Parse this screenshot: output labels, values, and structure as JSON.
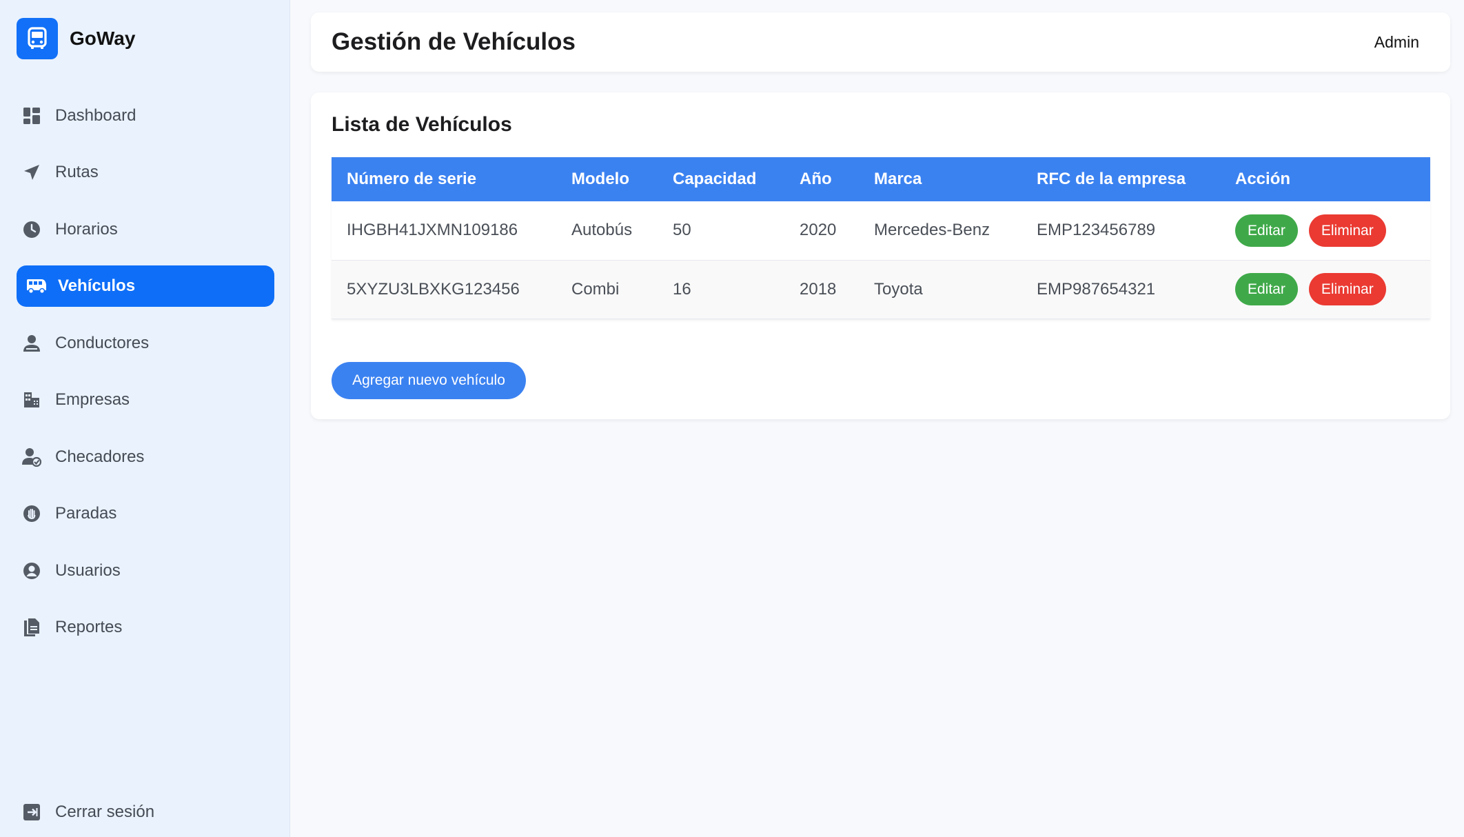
{
  "brand": {
    "name": "GoWay",
    "logo_icon": "bus-icon",
    "color": "#1170f7"
  },
  "sidebar": {
    "items": [
      {
        "label": "Dashboard",
        "icon": "dashboard-icon",
        "active": false
      },
      {
        "label": "Rutas",
        "icon": "navigation-arrow-icon",
        "active": false
      },
      {
        "label": "Horarios",
        "icon": "clock-icon",
        "active": false
      },
      {
        "label": "Vehículos",
        "icon": "bus-icon",
        "active": true
      },
      {
        "label": "Conductores",
        "icon": "driver-icon",
        "active": false
      },
      {
        "label": "Empresas",
        "icon": "building-icon",
        "active": false
      },
      {
        "label": "Checadores",
        "icon": "user-check-icon",
        "active": false
      },
      {
        "label": "Paradas",
        "icon": "hand-stop-icon",
        "active": false
      },
      {
        "label": "Usuarios",
        "icon": "user-circle-icon",
        "active": false
      },
      {
        "label": "Reportes",
        "icon": "document-copy-icon",
        "active": false
      }
    ],
    "logout_label": "Cerrar sesión",
    "logout_icon": "logout-icon"
  },
  "header": {
    "title": "Gestión de Vehículos",
    "user": "Admin"
  },
  "main": {
    "card_title": "Lista de Vehículos",
    "table": {
      "columns": [
        "Número de serie",
        "Modelo",
        "Capacidad",
        "Año",
        "Marca",
        "RFC de la empresa",
        "Acción"
      ],
      "rows": [
        [
          "IHGBH41JXMN109186",
          "Autobús",
          "50",
          "2020",
          "Mercedes-Benz",
          "EMP123456789"
        ],
        [
          "5XYZU3LBXKG123456",
          "Combi",
          "16",
          "2018",
          "Toyota",
          "EMP987654321"
        ]
      ],
      "edit_label": "Editar",
      "delete_label": "Eliminar"
    },
    "add_button_label": "Agregar nuevo vehículo"
  },
  "colors": {
    "accent": "#0e6ef7",
    "table_header": "#3b82f1",
    "edit": "#3fa949",
    "delete": "#ea3a32",
    "sidebar_bg": "#eaf2fd"
  }
}
